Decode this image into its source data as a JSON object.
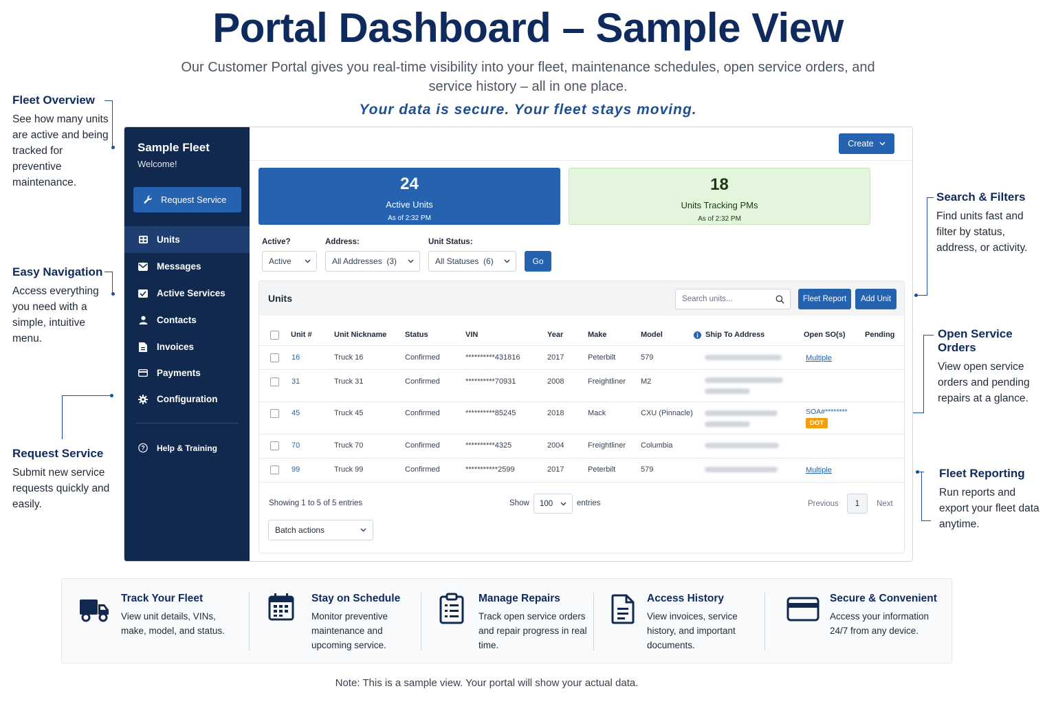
{
  "header": {
    "title": "Portal Dashboard – Sample View",
    "subtitle": "Our Customer Portal gives you real-time visibility into your fleet, maintenance schedules, open service orders, and service history – all in one place.",
    "tagline": "Your data is secure. Your fleet stays moving."
  },
  "callouts": {
    "fleet_overview": {
      "title": "Fleet Overview",
      "text": "See how many units are active and being tracked for preventive maintenance."
    },
    "easy_navigation": {
      "title": "Easy Navigation",
      "text": "Access everything you need with a simple, intuitive menu."
    },
    "request_service": {
      "title": "Request Service",
      "text": "Submit new service requests quickly and easily."
    },
    "search_filters": {
      "title": "Search & Filters",
      "text": "Find units fast and filter by status, address, or activity."
    },
    "open_service_orders": {
      "title": "Open Service Orders",
      "text": "View open service orders and pending repairs at a glance."
    },
    "fleet_reporting": {
      "title": "Fleet Reporting",
      "text": "Run reports and export your fleet data anytime."
    }
  },
  "sidebar": {
    "fleet_name": "Sample Fleet",
    "welcome": "Welcome!",
    "request_button": "Request Service",
    "items": [
      {
        "label": "Units",
        "icon": "units-icon"
      },
      {
        "label": "Messages",
        "icon": "envelope-icon"
      },
      {
        "label": "Active Services",
        "icon": "envelope-check-icon"
      },
      {
        "label": "Contacts",
        "icon": "person-icon"
      },
      {
        "label": "Invoices",
        "icon": "document-icon"
      },
      {
        "label": "Payments",
        "icon": "credit-card-icon"
      },
      {
        "label": "Configuration",
        "icon": "gear-icon"
      }
    ],
    "help": "Help & Training"
  },
  "toolbar": {
    "create": "Create"
  },
  "stats": [
    {
      "value": "24",
      "label": "Active Units",
      "as_of": "As of 2:32 PM"
    },
    {
      "value": "18",
      "label": "Units Tracking PMs",
      "as_of": "As of 2:32 PM"
    }
  ],
  "filters": {
    "active_label": "Active?",
    "active_value": "Active",
    "address_label": "Address:",
    "address_value": "All Addresses  (3)",
    "status_label": "Unit Status:",
    "status_value": "All Statuses  (6)",
    "go": "Go"
  },
  "units": {
    "title": "Units",
    "search_placeholder": "Search units...",
    "fleet_report": "Fleet Report",
    "add_unit": "Add Unit",
    "columns": [
      "Unit #",
      "Unit Nickname",
      "Status",
      "VIN",
      "Year",
      "Make",
      "Model",
      "Ship To Address",
      "Open SO(s)",
      "Pending"
    ],
    "rows": [
      {
        "unit": "16",
        "nickname": "Truck 16",
        "status": "Confirmed",
        "vin": "**********431816",
        "year": "2017",
        "make": "Peterbilt",
        "model": "579",
        "open_so": "Multiple",
        "pending": ""
      },
      {
        "unit": "31",
        "nickname": "Truck 31",
        "status": "Confirmed",
        "vin": "**********70931",
        "year": "2008",
        "make": "Freightliner",
        "model": "M2",
        "open_so": "",
        "pending": ""
      },
      {
        "unit": "45",
        "nickname": "Truck 45",
        "status": "Confirmed",
        "vin": "**********85245",
        "year": "2018",
        "make": "Mack",
        "model": "CXU (Pinnacle)",
        "open_so": "SOA#********",
        "badge": "DOT",
        "pending": ""
      },
      {
        "unit": "70",
        "nickname": "Truck 70",
        "status": "Confirmed",
        "vin": "**********4325",
        "year": "2004",
        "make": "Freightliner",
        "model": "Columbia",
        "open_so": "",
        "pending": ""
      },
      {
        "unit": "99",
        "nickname": "Truck 99",
        "status": "Confirmed",
        "vin": "***********2599",
        "year": "2017",
        "make": "Peterbilt",
        "model": "579",
        "open_so": "Multiple",
        "pending": ""
      }
    ],
    "showing": "Showing 1 to 5 of 5 entries",
    "show_label": "Show",
    "page_size": "100",
    "entries_label": "entries",
    "previous": "Previous",
    "page": "1",
    "next": "Next",
    "batch": "Batch actions"
  },
  "features": [
    {
      "title": "Track Your Fleet",
      "text": "View unit details, VINs, make, model, and status.",
      "icon": "truck-icon"
    },
    {
      "title": "Stay on Schedule",
      "text": "Monitor preventive maintenance and upcoming service.",
      "icon": "calendar-icon"
    },
    {
      "title": "Manage Repairs",
      "text": "Track open service orders and repair progress in real time.",
      "icon": "clipboard-icon"
    },
    {
      "title": "Access History",
      "text": "View invoices, service history, and important documents.",
      "icon": "document-icon"
    },
    {
      "title": "Secure & Convenient",
      "text": "Access your information 24/7 from any device.",
      "icon": "credit-card-icon"
    }
  ],
  "note": "Note: This is a sample view. Your portal will show your actual data.",
  "colors": {
    "navy": "#12294f",
    "primary": "#2563b0",
    "heading": "#0f2a5c",
    "green_bg": "#e3f5dc",
    "badge": "#f59e0b"
  }
}
